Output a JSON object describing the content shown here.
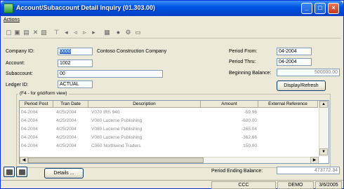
{
  "window": {
    "title": "Account/Subaccount Detail Inquiry (01.303.00)",
    "controls": [
      "_",
      "□",
      "×"
    ]
  },
  "menu": {
    "actions_label": "Actions"
  },
  "toolbar": {
    "icons": [
      "new-icon",
      "save-icon",
      "copy-icon",
      "delete-icon",
      "cut-icon",
      "filter-icon",
      "first-icon",
      "prev-icon",
      "next-icon",
      "last-icon",
      "print-icon",
      "help-icon",
      "customize-icon",
      "screen-icon"
    ],
    "glyphs": [
      "▢",
      "▣",
      "▤",
      "✕",
      "▧",
      "⊤",
      "◂",
      "◃",
      "▹",
      "▸",
      "▦",
      "●",
      "⚙",
      "▭"
    ]
  },
  "form": {
    "company_id_label": "Company ID:",
    "company_id_value": "0000",
    "company_name": "Contoso Construction Company",
    "account_label": "Account:",
    "account_value": "1002",
    "subaccount_label": "Subaccount:",
    "subaccount_value": "00",
    "ledger_id_label": "Ledger ID:",
    "ledger_id_value": "ACTUAL",
    "period_from_label": "Period From:",
    "period_from_value": "04-2004",
    "period_thru_label": "Period Thru:",
    "period_thru_value": "04-2004",
    "beginning_balance_label": "Beginning Balance:",
    "beginning_balance_value": "500000.00",
    "display_refresh_label": "Display/Refresh"
  },
  "grid": {
    "caption": "(F4 - for grid/form view)",
    "columns": [
      "Period Post",
      "Tran Date",
      "Description",
      "Amount",
      "External Reference"
    ],
    "rows": [
      [
        "04-2004",
        "4/25/2004",
        "V070 IRS 940",
        "-59.96",
        ""
      ],
      [
        "04-2004",
        "4/25/2004",
        "V080 Lucerne Publishing",
        "-600.00",
        ""
      ],
      [
        "04-2004",
        "4/25/2004",
        "V080 Lucerne Publishing",
        "-265.04",
        ""
      ],
      [
        "04-2004",
        "4/25/2004",
        "V080 Lucerne Publishing",
        "-362.66",
        ""
      ],
      [
        "04-2004",
        "4/25/2004",
        "C060 Northwind Traders",
        "150.00",
        ""
      ]
    ]
  },
  "footer": {
    "details_label": "Details ...",
    "period_ending_balance_label": "Period Ending Balance:",
    "period_ending_balance_value": "473772.34"
  },
  "status": {
    "company": "CCC",
    "database": "DEMO",
    "date": "3/6/2005"
  }
}
